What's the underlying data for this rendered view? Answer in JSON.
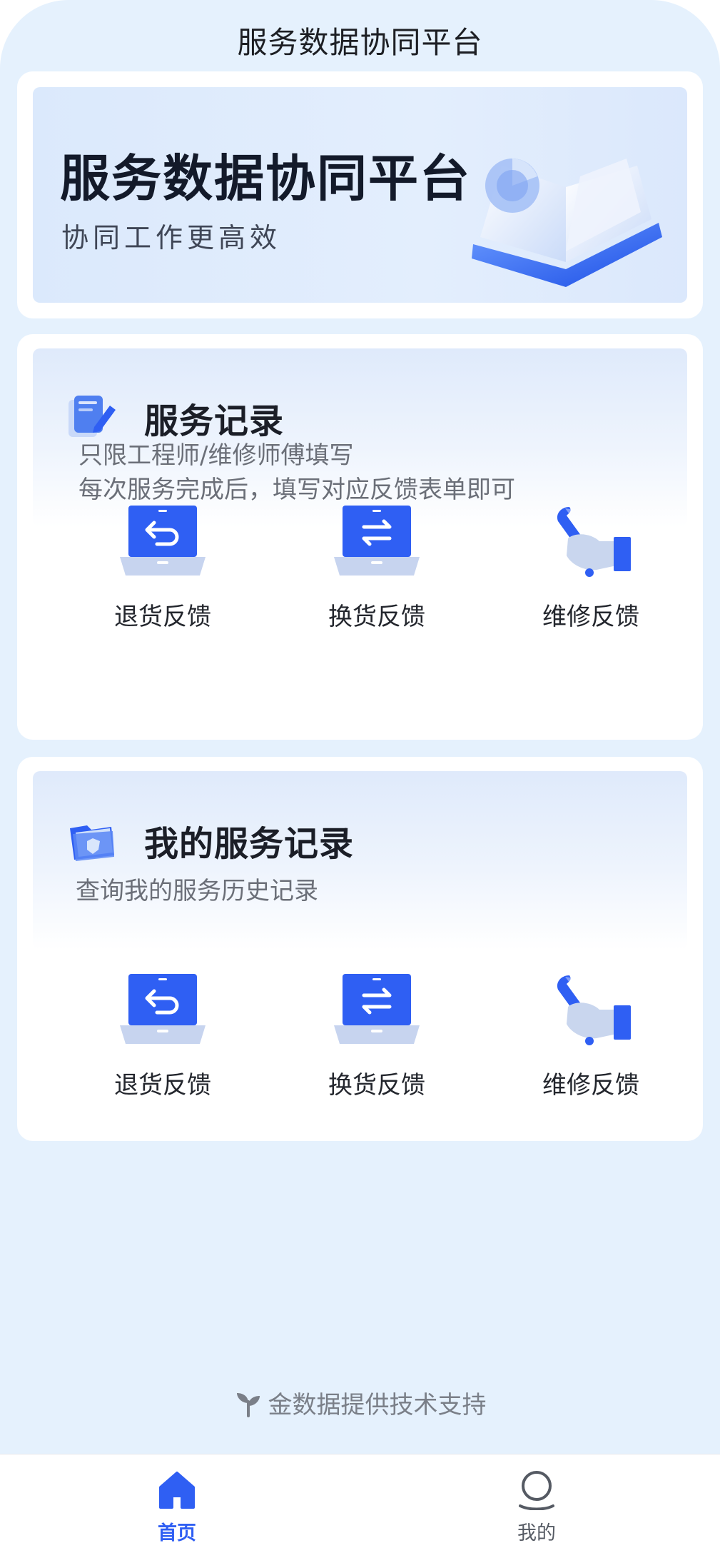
{
  "header": {
    "title": "服务数据协同平台"
  },
  "banner": {
    "title": "服务数据协同平台",
    "subtitle": "协同工作更高效"
  },
  "service_record": {
    "title": "服务记录",
    "desc_line1": "只限工程师/维修师傅填写",
    "desc_line2": "每次服务完成后，填写对应反馈表单即可",
    "items": [
      {
        "label": "退货反馈",
        "icon": "return-laptop-icon"
      },
      {
        "label": "换货反馈",
        "icon": "exchange-laptop-icon"
      },
      {
        "label": "维修反馈",
        "icon": "repair-wrench-icon"
      }
    ]
  },
  "my_records": {
    "title": "我的服务记录",
    "desc": "查询我的服务历史记录",
    "items": [
      {
        "label": "退货反馈",
        "icon": "return-laptop-icon"
      },
      {
        "label": "换货反馈",
        "icon": "exchange-laptop-icon"
      },
      {
        "label": "维修反馈",
        "icon": "repair-wrench-icon"
      }
    ]
  },
  "footer": {
    "credit": "金数据提供技术支持"
  },
  "tabbar": {
    "tabs": [
      {
        "label": "首页",
        "icon": "home-icon",
        "active": true
      },
      {
        "label": "我的",
        "icon": "user-icon",
        "active": false
      }
    ]
  },
  "colors": {
    "accent": "#2f5ff3",
    "background": "#e5f1fd"
  }
}
